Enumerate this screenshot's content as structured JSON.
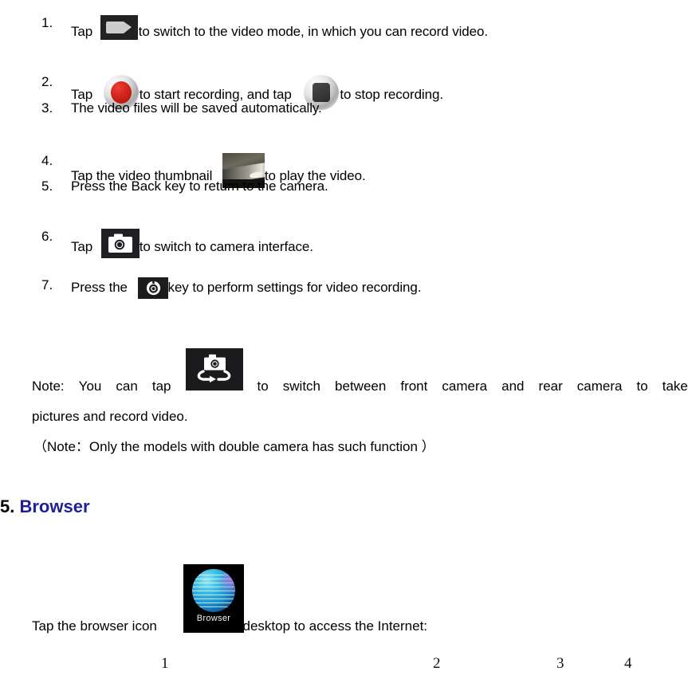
{
  "document": {
    "steps": [
      {
        "number": "1.",
        "text_before": "Tap",
        "icon": "video-camera-icon",
        "text_after": "to switch to the video mode, in which you can record video."
      },
      {
        "number": "2.",
        "text_before": "Tap",
        "icon": "record-button-icon",
        "text_middle": "to start recording, and tap",
        "icon2": "stop-button-icon",
        "text_after": "to stop recording."
      },
      {
        "number": "3.",
        "text_before": "The video files will be saved automatically."
      },
      {
        "number": "4.",
        "text_before": "Tap the video thumbnail",
        "icon": "video-thumbnail-icon",
        "text_after": "to play the video."
      },
      {
        "number": "5.",
        "text_before": "Press the Back key to return to the camera."
      },
      {
        "number": "6.",
        "text_before": "Tap",
        "icon": "camera-mode-icon",
        "text_after": "to switch to camera interface."
      },
      {
        "number": "7.",
        "text_before": "Press the",
        "icon": "settings-icon",
        "text_after": "key to perform settings for video recording."
      }
    ],
    "note": {
      "line1_words": [
        "Note:",
        "You",
        "can",
        "tap"
      ],
      "icon": "switch-camera-icon",
      "line1_words_after": [
        "to",
        "switch",
        "between",
        "front",
        "camera",
        "and",
        "rear",
        "camera",
        "to",
        "take"
      ],
      "line2": "pictures and record video."
    },
    "paren_note": "（Note：Only the models with double camera has such function  ）",
    "heading": {
      "number": "5.",
      "title": "Browser",
      "color": "#1f1f9c"
    },
    "browser_line": {
      "text_before": "Tap the browser icon",
      "icon": "browser-app-icon",
      "icon_label": "Browser",
      "text_after": "on desktop to access the Internet:"
    },
    "footer_numbers": [
      "1",
      "2",
      "3",
      "4"
    ]
  }
}
